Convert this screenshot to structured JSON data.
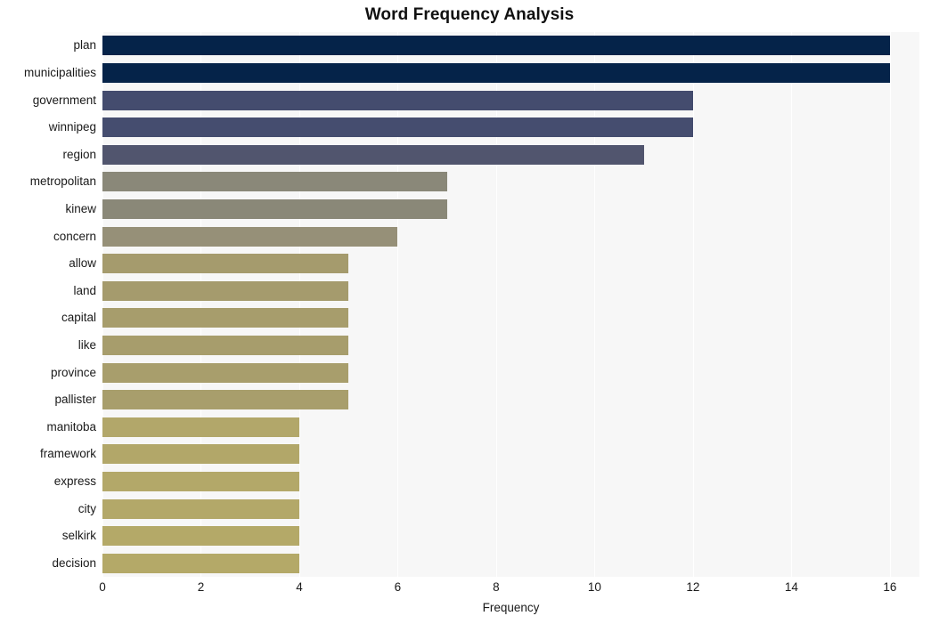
{
  "chart_data": {
    "type": "bar",
    "orientation": "horizontal",
    "title": "Word Frequency Analysis",
    "xlabel": "Frequency",
    "ylabel": "",
    "xlim": [
      0,
      16.6
    ],
    "xticks": [
      0,
      2,
      4,
      6,
      8,
      10,
      12,
      14,
      16
    ],
    "xtick_labels": [
      "0",
      "2",
      "4",
      "6",
      "8",
      "10",
      "12",
      "14",
      "16"
    ],
    "grid": "vertical",
    "legend": "none",
    "categories": [
      "plan",
      "municipalities",
      "government",
      "winnipeg",
      "region",
      "metropolitan",
      "kinew",
      "concern",
      "allow",
      "land",
      "capital",
      "like",
      "province",
      "pallister",
      "manitoba",
      "framework",
      "express",
      "city",
      "selkirk",
      "decision"
    ],
    "values": [
      16,
      16,
      12,
      12,
      11,
      7,
      7,
      6,
      5,
      5,
      5,
      5,
      5,
      5,
      4,
      4,
      4,
      4,
      4,
      4
    ],
    "bar_colors": [
      "#052349",
      "#052349",
      "#444c6e",
      "#454d6f",
      "#51556e",
      "#8a8879",
      "#8a8878",
      "#969078",
      "#a59b6d",
      "#a59b6d",
      "#a79d6c",
      "#a79d6c",
      "#a89e6c",
      "#a89e6c",
      "#b2a76a",
      "#b2a769",
      "#b3a869",
      "#b3a869",
      "#b4a968",
      "#b4a968"
    ]
  },
  "colors": {
    "plot_background": "#f7f7f7",
    "figure_background": "#ffffff",
    "gridline": "#ffffff",
    "text": "#1a1a1a",
    "title": "#111111"
  }
}
